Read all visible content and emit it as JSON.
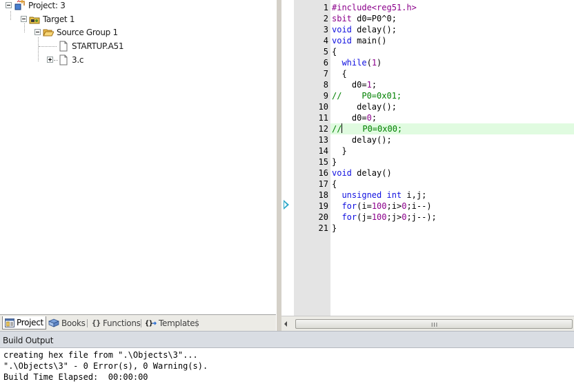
{
  "project_tree": {
    "project": "Project: 3",
    "target": "Target 1",
    "group": "Source Group 1",
    "files": [
      "STARTUP.A51",
      "3.c"
    ]
  },
  "tabs": [
    "Project",
    "Books",
    "Functions",
    "Templates"
  ],
  "active_tab": "Project",
  "editor": {
    "highlighted_line": 12,
    "current_line_marker": 19,
    "lines": [
      {
        "n": "1"
      },
      {
        "n": "2"
      },
      {
        "n": "3"
      },
      {
        "n": "4"
      },
      {
        "n": "5"
      },
      {
        "n": "6"
      },
      {
        "n": "7"
      },
      {
        "n": "8"
      },
      {
        "n": "9"
      },
      {
        "n": "10"
      },
      {
        "n": "11"
      },
      {
        "n": "12"
      },
      {
        "n": "13"
      },
      {
        "n": "14"
      },
      {
        "n": "15"
      },
      {
        "n": "16"
      },
      {
        "n": "17"
      },
      {
        "n": "18"
      },
      {
        "n": "19"
      },
      {
        "n": "20"
      },
      {
        "n": "21"
      }
    ],
    "code": {
      "l1_a": "#include",
      "l1_b": "<reg51.h>",
      "l2_a": "sbit",
      "l2_b": " d0=P0^0;",
      "l3_a": "void",
      "l3_b": " delay();",
      "l4_a": "void",
      "l4_b": " main()",
      "l5": "{",
      "l6_pre": "  ",
      "l6_kw": "while",
      "l6_p1": "(",
      "l6_num": "1",
      "l6_p2": ")",
      "l7": "  {",
      "l8_a": "    d0=",
      "l8_num": "1",
      "l8_b": ";",
      "l9": "//    P0=0x01;",
      "l10": "     delay();",
      "l11_a": "    d0=",
      "l11_num": "0",
      "l11_b": ";",
      "l12_a": "//",
      "l12_b": "    P0=0x00;",
      "l13": "    delay();",
      "l14": "  }",
      "l15": "}",
      "l16_a": "void",
      "l16_b": " delay()",
      "l17": "{",
      "l18_pre": "  ",
      "l18_kw1": "unsigned",
      "l18_sp": " ",
      "l18_kw2": "int",
      "l18_rest": " i,j;",
      "l19_pre": "  ",
      "l19_kw": "for",
      "l19_a": "(i=",
      "l19_n1": "100",
      "l19_b": ";i>",
      "l19_n2": "0",
      "l19_c": ";i--)",
      "l20_pre": "  ",
      "l20_kw": "for",
      "l20_a": "(j=",
      "l20_n1": "100",
      "l20_b": ";j>",
      "l20_n2": "0",
      "l20_c": ";j--);",
      "l21": "}"
    }
  },
  "scrollbar": {
    "grip": "III"
  },
  "build": {
    "title": "Build Output",
    "lines": [
      "creating hex file from \".\\Objects\\3\"...",
      "\".\\Objects\\3\" - 0 Error(s), 0 Warning(s).",
      "Build Time Elapsed:  00:00:00"
    ]
  },
  "colors": {
    "keyword": "#1010e0",
    "preprocessor": "#8b008b",
    "number": "#8b008b",
    "comment": "#008000",
    "highlight": "#e0fbe0",
    "gutter": "#e4e4e4",
    "exec_arrow": "#2aa7c8"
  }
}
